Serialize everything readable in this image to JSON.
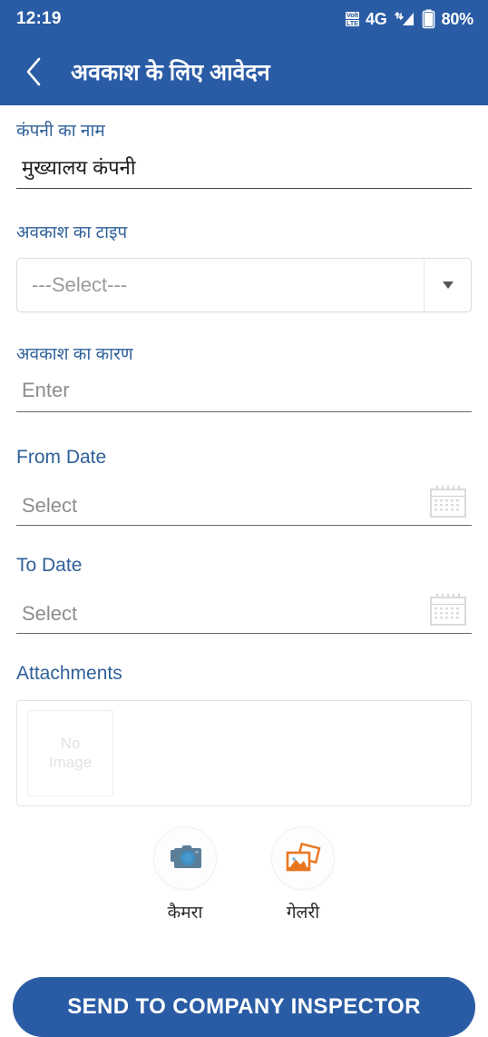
{
  "status_bar": {
    "time": "12:19",
    "volte_top": "Volt",
    "volte_bottom": "LTE",
    "network": "4G",
    "battery_percent": "80%"
  },
  "app_bar": {
    "title": "अवकाश के लिए आवेदन",
    "back_icon": "chevron-left-icon"
  },
  "form": {
    "company_name": {
      "label": "कंपनी का नाम",
      "value": "मुख्यालय कंपनी"
    },
    "leave_type": {
      "label": "अवकाश का टाइप",
      "selected": "---Select---"
    },
    "leave_reason": {
      "label": "अवकाश का कारण",
      "placeholder": "Enter",
      "value": ""
    },
    "from_date": {
      "label": "From Date",
      "placeholder": "Select",
      "value": "",
      "icon": "calendar-icon"
    },
    "to_date": {
      "label": "To Date",
      "placeholder": "Select",
      "value": "",
      "icon": "calendar-icon"
    },
    "attachments": {
      "label": "Attachments",
      "placeholder_line1": "No",
      "placeholder_line2": "Image",
      "camera": {
        "label": "कैमरा",
        "icon": "camera-icon"
      },
      "gallery": {
        "label": "गेलरी",
        "icon": "gallery-icon"
      }
    }
  },
  "submit": {
    "label": "SEND TO COMPANY INSPECTOR"
  },
  "colors": {
    "primary": "#2a5ca5",
    "label_blue": "#2f6099",
    "placeholder_gray": "#8d8d8d",
    "camera_icon": "#5c7f99",
    "camera_lens": "#3d8fc4",
    "gallery_icon": "#e8761e"
  }
}
